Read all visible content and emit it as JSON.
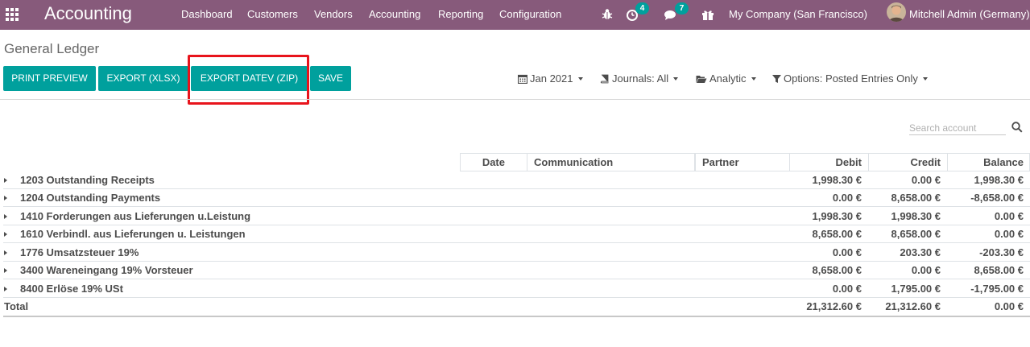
{
  "navbar": {
    "app_title": "Accounting",
    "menu": [
      "Dashboard",
      "Customers",
      "Vendors",
      "Accounting",
      "Reporting",
      "Configuration"
    ],
    "activity_count": "4",
    "messages_count": "7",
    "company": "My Company (San Francisco)",
    "user": "Mitchell Admin (Germany)",
    "brand_color": "#875a7b",
    "badge_color": "#00a09d"
  },
  "page": {
    "title": "General Ledger"
  },
  "toolbar": {
    "buttons": [
      "PRINT PREVIEW",
      "EXPORT (XLSX)",
      "EXPORT DATEV (ZIP)",
      "SAVE"
    ],
    "button_color": "#00a09d",
    "highlight_color": "#e8141c"
  },
  "filters": {
    "date": "Jan 2021",
    "journals": "Journals: All",
    "analytic": "Analytic",
    "options": "Options: Posted Entries Only"
  },
  "search": {
    "placeholder": "Search account"
  },
  "table": {
    "columns": [
      "Date",
      "Communication",
      "Partner",
      "Debit",
      "Credit",
      "Balance"
    ],
    "rows": [
      {
        "account": "1203 Outstanding Receipts",
        "debit": "1,998.30 €",
        "credit": "0.00 €",
        "balance": "1,998.30 €"
      },
      {
        "account": "1204 Outstanding Payments",
        "debit": "0.00 €",
        "credit": "8,658.00 €",
        "balance": "-8,658.00 €"
      },
      {
        "account": "1410 Forderungen aus Lieferungen u.Leistung",
        "debit": "1,998.30 €",
        "credit": "1,998.30 €",
        "balance": "0.00 €"
      },
      {
        "account": "1610 Verbindl. aus Lieferungen u. Leistungen",
        "debit": "8,658.00 €",
        "credit": "8,658.00 €",
        "balance": "0.00 €"
      },
      {
        "account": "1776 Umsatzsteuer 19%",
        "debit": "0.00 €",
        "credit": "203.30 €",
        "balance": "-203.30 €"
      },
      {
        "account": "3400 Wareneingang 19% Vorsteuer",
        "debit": "8,658.00 €",
        "credit": "0.00 €",
        "balance": "8,658.00 €"
      },
      {
        "account": "8400 Erlöse 19% USt",
        "debit": "0.00 €",
        "credit": "1,795.00 €",
        "balance": "-1,795.00 €"
      }
    ],
    "total": {
      "label": "Total",
      "debit": "21,312.60 €",
      "credit": "21,312.60 €",
      "balance": "0.00 €"
    }
  }
}
